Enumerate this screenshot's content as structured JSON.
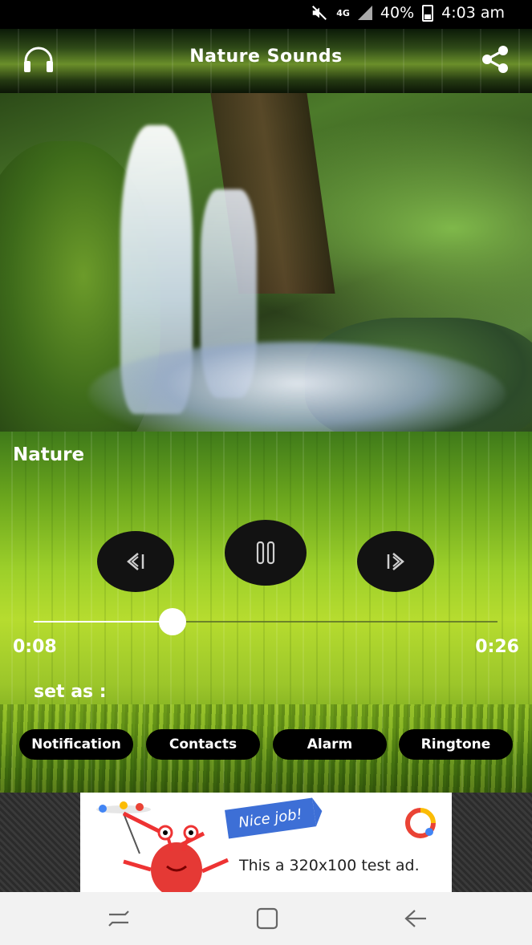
{
  "status_bar": {
    "network": "4G",
    "battery": "40%",
    "time": "4:03 am",
    "icons": [
      "mute-icon",
      "signal-icon",
      "battery-icon"
    ]
  },
  "app_bar": {
    "title": "Nature Sounds",
    "left_icon": "headphones-icon",
    "right_icon": "share-icon"
  },
  "player": {
    "track_title": "Nature",
    "current_time": "0:08",
    "duration": "0:26",
    "progress": 0.3,
    "controls": [
      "previous-icon",
      "pause-icon",
      "next-icon"
    ]
  },
  "set_as": {
    "label": "set as :",
    "buttons": [
      "Notification",
      "Contacts",
      "Alarm",
      "Ringtone"
    ]
  },
  "ad": {
    "badge": "Nice job!",
    "text": "This a 320x100 test ad."
  },
  "nav_bar": {
    "icons": [
      "recents-icon",
      "home-icon",
      "back-icon"
    ]
  },
  "colors": {
    "control_bg": "#121212",
    "pill_bg": "#000000",
    "ad_badge": "#3d6fd6",
    "nav_bg": "#f2f2f2"
  }
}
